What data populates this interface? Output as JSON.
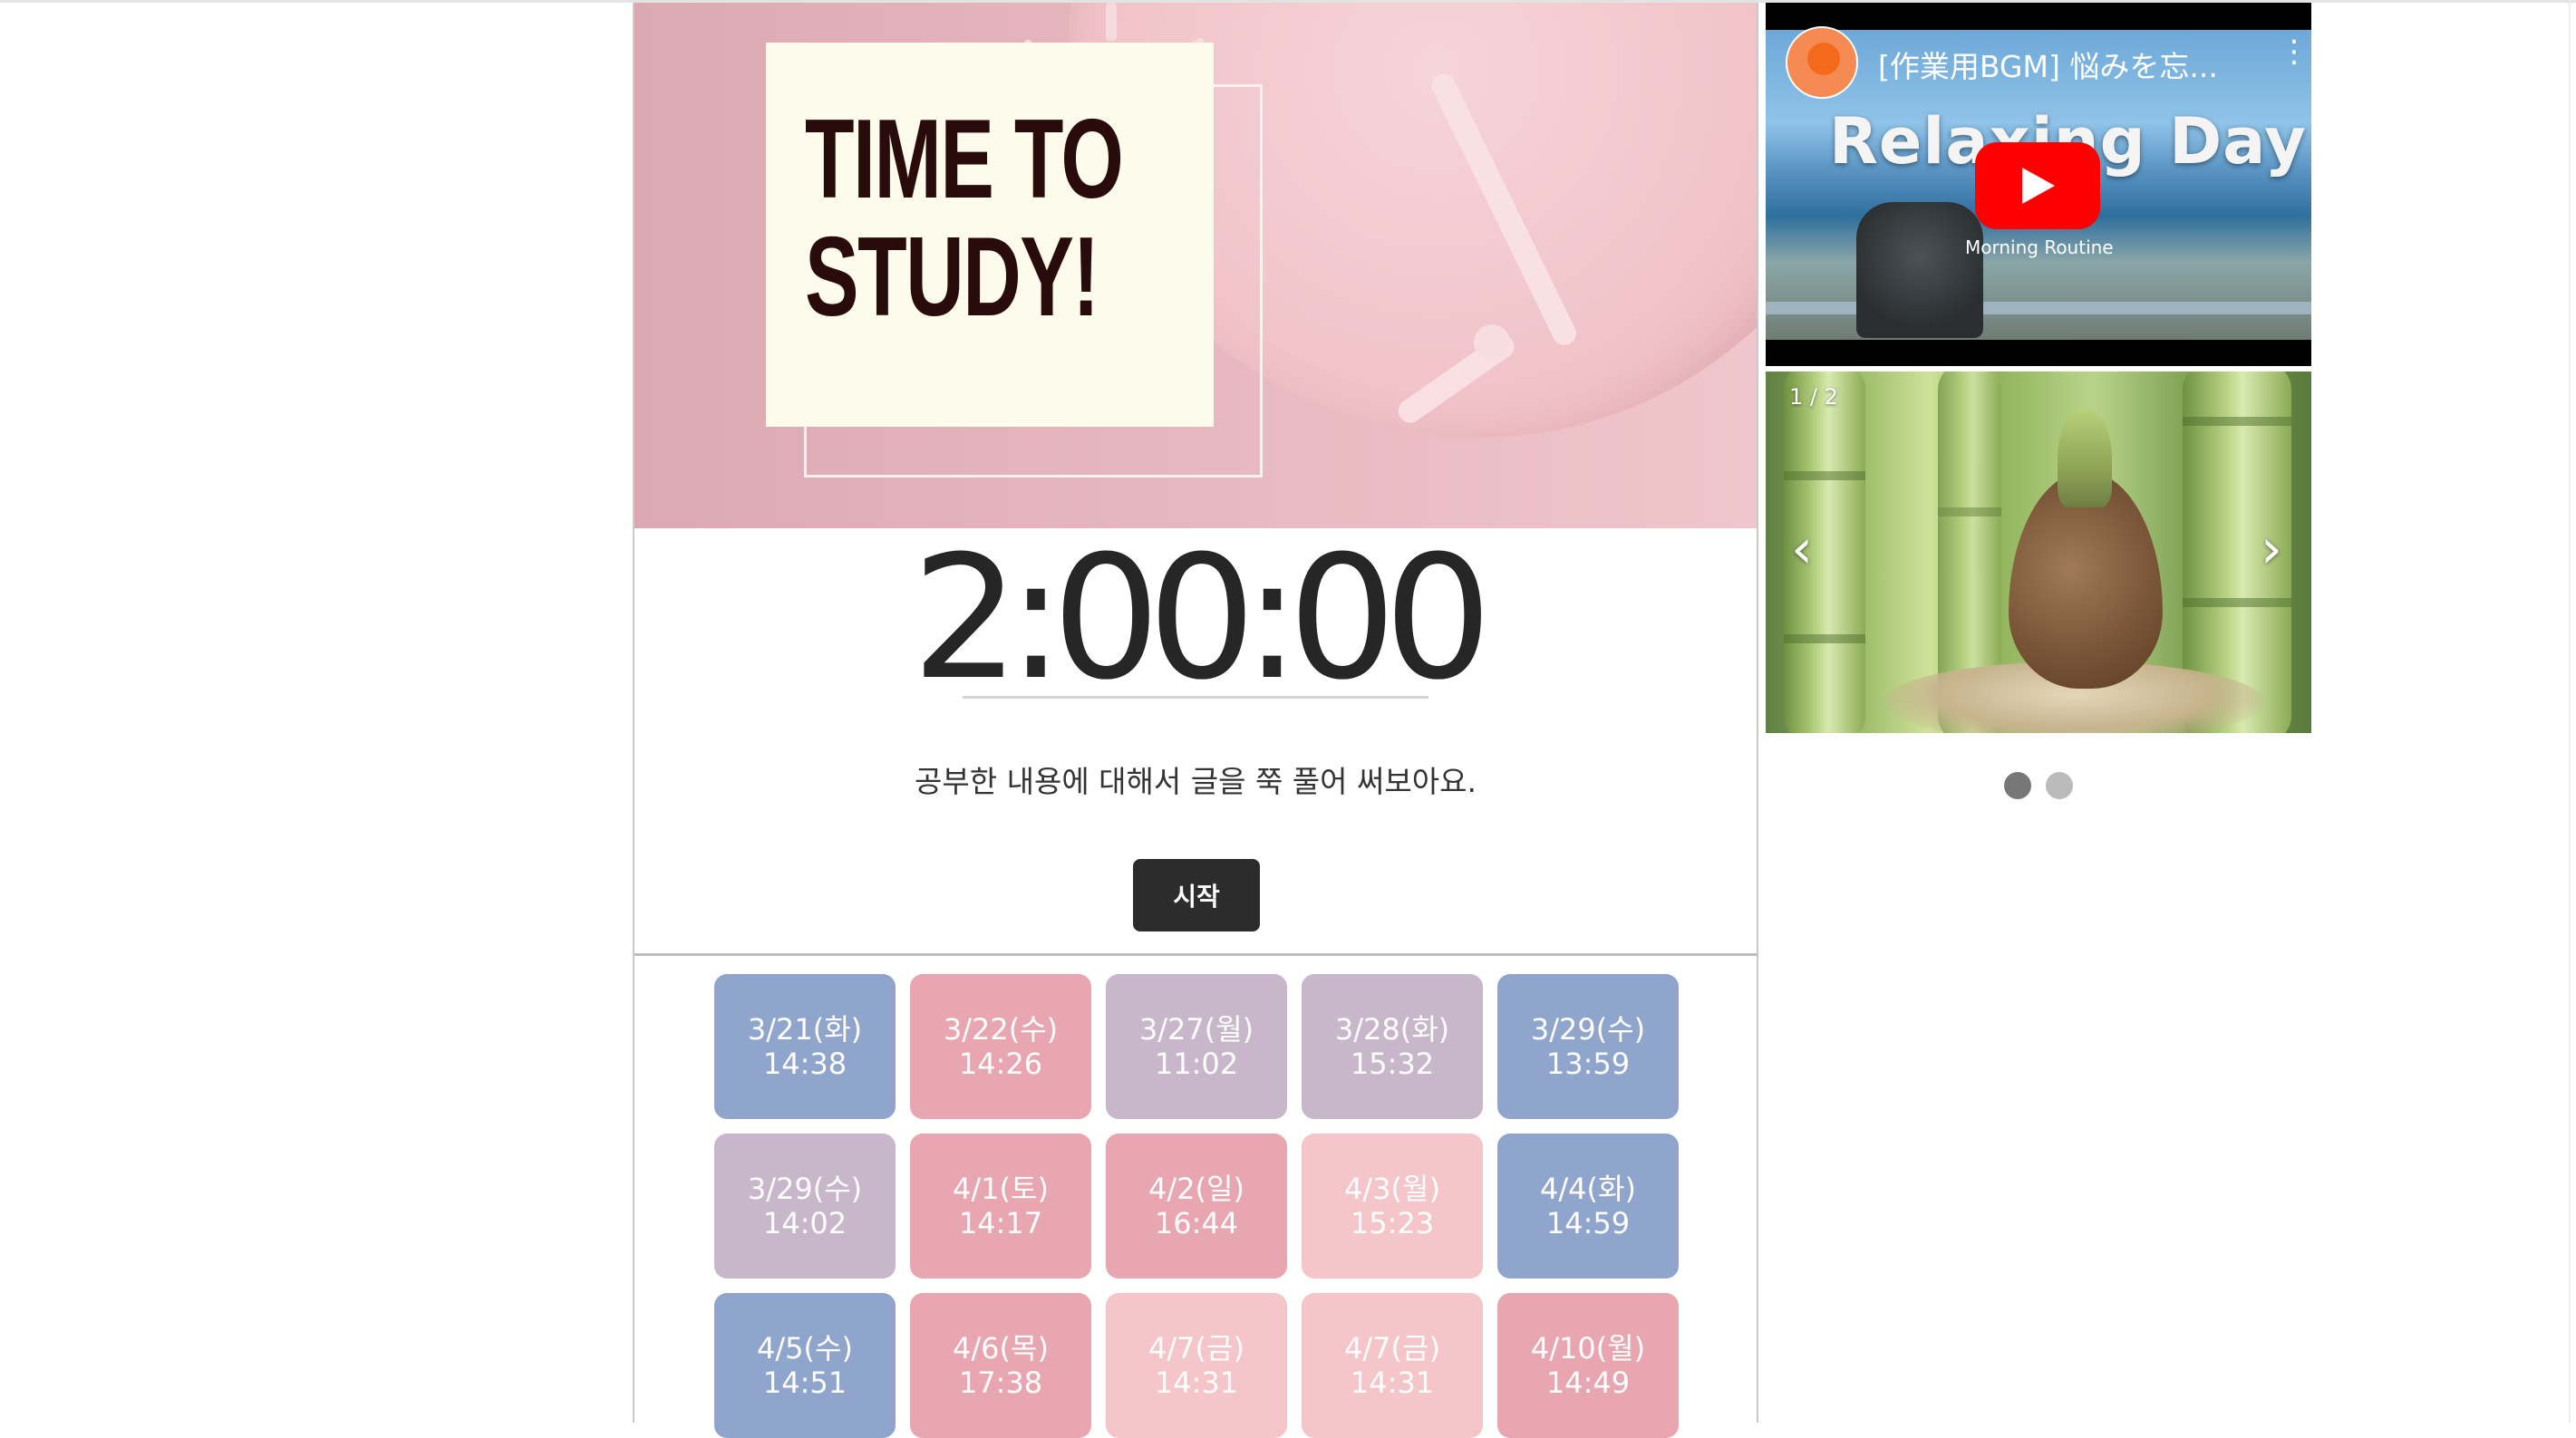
{
  "banner": {
    "title_line1": "TIME TO",
    "title_line2": "STUDY!"
  },
  "timer": {
    "display": "2:00:00"
  },
  "prompt": {
    "text": "공부한 내용에 대해서 글을 쭉 풀어 써보아요."
  },
  "controls": {
    "start_label": "시작"
  },
  "records": [
    {
      "date": "3/21(화)",
      "time": "14:38",
      "color": "#8fa5cc"
    },
    {
      "date": "3/22(수)",
      "time": "14:26",
      "color": "#e8a6b1"
    },
    {
      "date": "3/27(월)",
      "time": "11:02",
      "color": "#c8b6cb"
    },
    {
      "date": "3/28(화)",
      "time": "15:32",
      "color": "#c8b6cb"
    },
    {
      "date": "3/29(수)",
      "time": "13:59",
      "color": "#8fa5cc"
    },
    {
      "date": "3/29(수)",
      "time": "14:02",
      "color": "#c8b6cb"
    },
    {
      "date": "4/1(토)",
      "time": "14:17",
      "color": "#e8a6b1"
    },
    {
      "date": "4/2(일)",
      "time": "16:44",
      "color": "#e8a6b1"
    },
    {
      "date": "4/3(월)",
      "time": "15:23",
      "color": "#f5c6c9"
    },
    {
      "date": "4/4(화)",
      "time": "14:59",
      "color": "#8fa5cc"
    },
    {
      "date": "4/5(수)",
      "time": "14:51",
      "color": "#8fa5cc"
    },
    {
      "date": "4/6(목)",
      "time": "17:38",
      "color": "#e8a6b1"
    },
    {
      "date": "4/7(금)",
      "time": "14:31",
      "color": "#f5c6c9"
    },
    {
      "date": "4/7(금)",
      "time": "14:31",
      "color": "#f5c6c9"
    },
    {
      "date": "4/10(월)",
      "time": "14:49",
      "color": "#e8a6b1"
    }
  ],
  "video": {
    "title": "[作業用BGM] 悩みを忘...",
    "overlay_text": "Relaxing Day",
    "overlay_subtext": "Morning Routine",
    "icons": [
      "channel-avatar",
      "more-options-icon",
      "youtube-play-icon"
    ]
  },
  "carousel": {
    "counter": "1 / 2",
    "prev_arrow": "‹",
    "next_arrow": "›",
    "active_index": 0,
    "total": 2,
    "dot_colors": {
      "active": "#777777",
      "inactive": "#bbbbbb"
    }
  },
  "colors": {
    "accent_dark": "#2c2c2c",
    "tile_blue": "#8fa5cc",
    "tile_pink": "#e8a6b1",
    "tile_lavender": "#c8b6cb",
    "tile_light_pink": "#f5c6c9"
  }
}
